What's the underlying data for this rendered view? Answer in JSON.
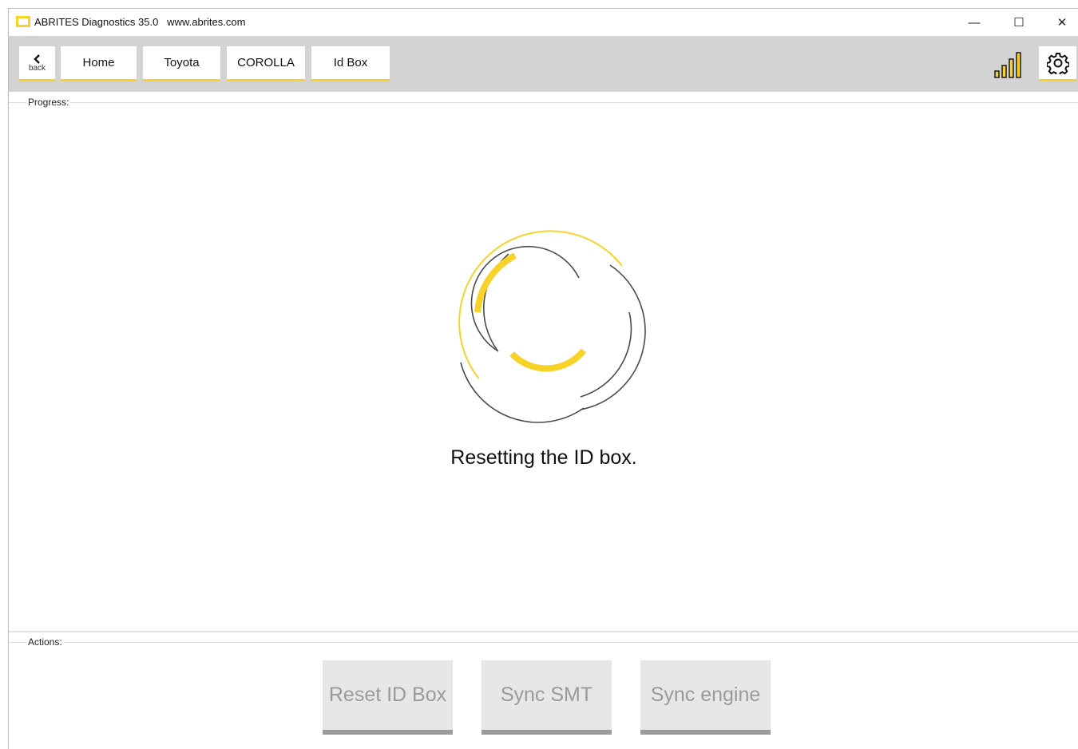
{
  "window": {
    "title": "ABRITES Diagnostics 35.0   www.abrites.com",
    "controls": {
      "minimize": "—",
      "maximize": "☐",
      "close": "✕"
    }
  },
  "nav": {
    "back_label": "back",
    "back_icon": "chevron-left-icon",
    "breadcrumbs": [
      {
        "label": "Home"
      },
      {
        "label": "Toyota"
      },
      {
        "label": "COROLLA"
      },
      {
        "label": "Id Box"
      }
    ],
    "signal_icon": "signal-strength-icon",
    "settings_icon": "gear-icon"
  },
  "progress": {
    "group_label": "Progress:",
    "status_text": "Resetting the ID box."
  },
  "actions": {
    "group_label": "Actions:",
    "buttons": [
      {
        "label": "Reset ID Box"
      },
      {
        "label": "Sync SMT"
      },
      {
        "label": "Sync engine"
      }
    ]
  },
  "colors": {
    "accent": "#f7d32a",
    "toolbar_bg": "#d3d3d3",
    "button_disabled_bg": "#e7e7e7",
    "button_disabled_text": "#9a9a9a"
  }
}
